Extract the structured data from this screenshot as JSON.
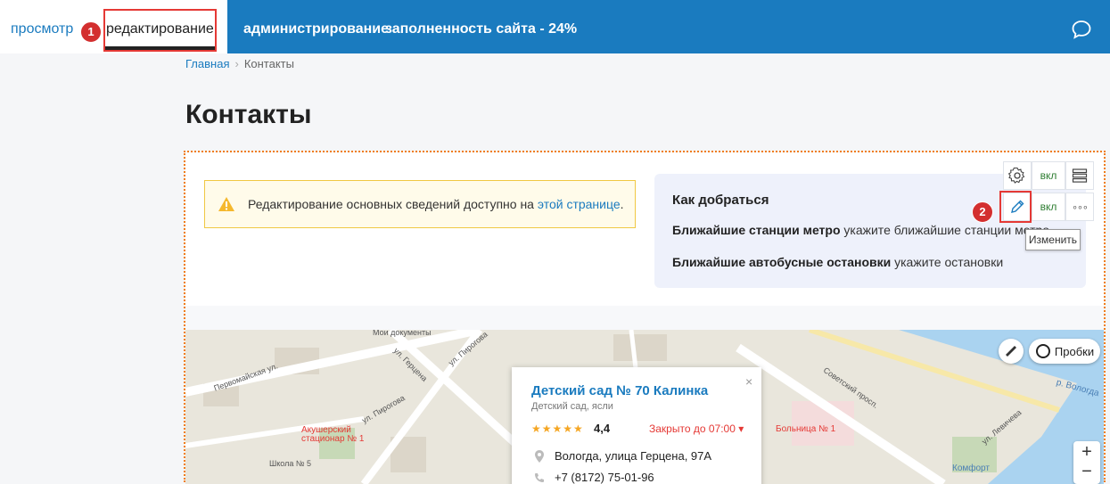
{
  "topbar": {
    "view_label": "просмотр",
    "edit_label": "редактирование",
    "admin_label": "администрирование",
    "fill_label": "заполненность сайта - 24%",
    "accent": "#1a7bbf"
  },
  "badges": {
    "one": "1",
    "two": "2"
  },
  "breadcrumb": {
    "home": "Главная",
    "sep": "›",
    "current": "Контакты"
  },
  "page": {
    "title": "Контакты"
  },
  "warning": {
    "text": "Редактирование основных сведений доступно на ",
    "link": "этой странице",
    "tail": "."
  },
  "info": {
    "title": "Как добраться",
    "metro_bold": "Ближайшие станции метро",
    "metro_text": " укажите ближайшие станции метро",
    "bus_bold": "Ближайшие автобусные остановки",
    "bus_text": " укажите остановки"
  },
  "toolbar": {
    "vkl1": "вкл",
    "vkl2": "вкл",
    "more": "∘∘∘",
    "tooltip": "Изменить"
  },
  "map": {
    "traffic_label": "Пробки",
    "zoom_in": "+",
    "zoom_out": "−",
    "labels": {
      "l1": "Мои документы",
      "l2": "Первомайская ул.",
      "l3": "ул. Герцена",
      "l4": "ул. Пирогова",
      "l5": "ул. Пирогова",
      "l6": "Акушерский стационар № 1",
      "l7": "Школа № 5",
      "l8": "Советский просп.",
      "l9": "Больница № 1",
      "l10": "р. Вологда",
      "l11": "ул. Левичева",
      "l12": "Комфорт"
    },
    "popup": {
      "name": "Детский сад № 70 Калинка",
      "type": "Детский сад, ясли",
      "stars": "★★★★★",
      "rating": "4,4",
      "closed": "Закрыто до 07:00 ▾",
      "address": "Вологда, улица Герцена, 97А",
      "phone": "+7 (8172) 75-01-96",
      "close": "×"
    }
  }
}
